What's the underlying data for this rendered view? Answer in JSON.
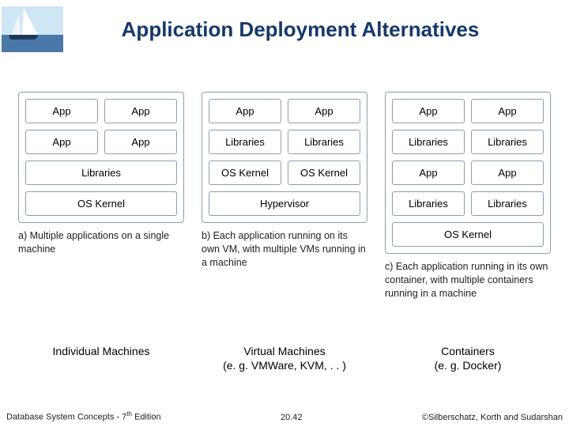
{
  "title": "Application Deployment Alternatives",
  "columns": {
    "a": {
      "apps_row1": [
        "App",
        "App"
      ],
      "apps_row2": [
        "App",
        "App"
      ],
      "libs": "Libraries",
      "kernel": "OS Kernel",
      "caption": "a) Multiple applications on a single machine",
      "subtitle": "Individual Machines"
    },
    "b": {
      "apps": [
        "App",
        "App"
      ],
      "libs": [
        "Libraries",
        "Libraries"
      ],
      "kernels": [
        "OS Kernel",
        "OS Kernel"
      ],
      "hypervisor": "Hypervisor",
      "caption": "b) Each application running on its own VM, with multiple VMs running in a machine",
      "subtitle_line1": "Virtual Machines",
      "subtitle_line2": "(e. g. VMWare, KVM, . . )"
    },
    "c": {
      "apps_row1": [
        "App",
        "App"
      ],
      "libs_row1": [
        "Libraries",
        "Libraries"
      ],
      "apps_row2": [
        "App",
        "App"
      ],
      "libs_row2": [
        "Libraries",
        "Libraries"
      ],
      "kernel": "OS Kernel",
      "caption": "c) Each application running in its own container, with multiple containers running in a machine",
      "subtitle_line1": "Containers",
      "subtitle_line2": "(e. g. Docker)"
    }
  },
  "footer": {
    "left_pre": "Database System Concepts - 7",
    "left_sup": "th",
    "left_post": " Edition",
    "mid": "20.42",
    "right": "©Silberschatz, Korth and Sudarshan"
  }
}
